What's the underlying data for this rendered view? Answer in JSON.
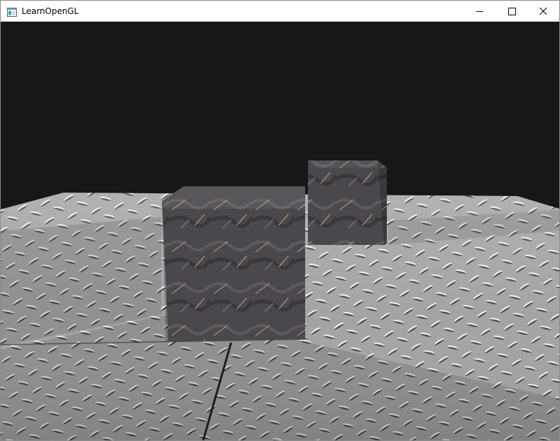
{
  "window": {
    "title": "LearnOpenGL",
    "icon": "window-app-icon"
  },
  "titlebar_buttons": [
    {
      "icon": "minimize-icon"
    },
    {
      "icon": "maximize-icon"
    },
    {
      "icon": "close-icon"
    }
  ],
  "scene": {
    "clear_color": "#171717",
    "floor_color": "#a8a8a8",
    "cube_color": "#4a474c",
    "cube_vein_color": "#c8c27a"
  }
}
